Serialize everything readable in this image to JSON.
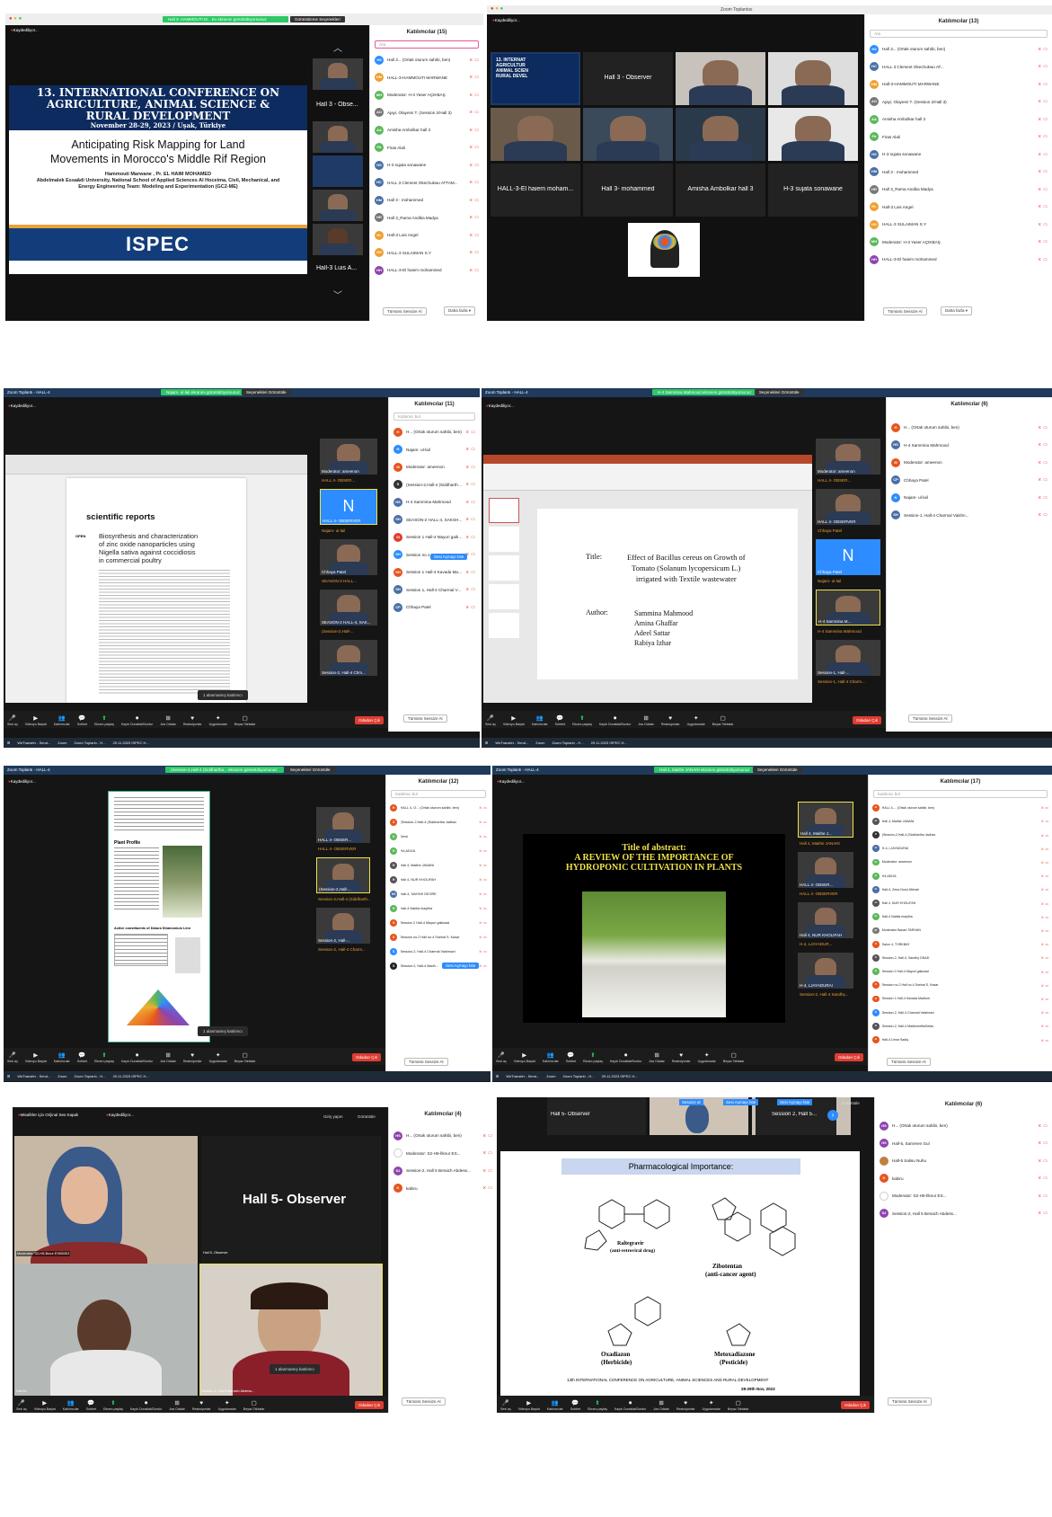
{
  "sc1": {
    "record_label": "Kaydediliyor...",
    "share_banner": "Hall 3- HAMMOUTI M... Ev ekranını görüntülüyorsunuz",
    "view_options": "Görüntüleme Seçenekleri",
    "conf_title_1": "13. INTERNATIONAL CONFERENCE ON",
    "conf_title_2": "AGRICULTURE, ANIMAL SCIENCE &",
    "conf_title_3": "RURAL DEVELOPMENT",
    "conf_date": "November 28-29, 2023 / Uşak, Türkiye",
    "talk_title_1": "Anticipating Risk Mapping for Land",
    "talk_title_2": "Movements in Morocco's Middle Rif Region",
    "authors": "Hammouti Marwane , Pr. EL HAIM MOHAMED",
    "affiliation_1": "Abdelmalek Essaâdi University, National School of Applied Sciences Al Hoceima, Civil, Mechanical, and",
    "affiliation_2": "Energy Engineering Team: Modeling and Experimentation (GC2-ME)",
    "logo_text": "ISPEC",
    "thumb_labels": [
      "Hall 3 - Obse...",
      "Hall-3 Luis A..."
    ],
    "panel_title": "Katılımcılar (15)",
    "search": "Ara",
    "participants": [
      {
        "i": "H3",
        "n": "Hall 3... (Ortak oturum sahibi, ben)",
        "c": "#2d8cff"
      },
      {
        "i": "HM",
        "n": "HALL-3-HAMMOUTI MARWANE",
        "c": "#f0a030"
      },
      {
        "i": "MH",
        "n": "Moderator: H-3 Yaser AÇIKBAŞ",
        "c": "#5cb85c"
      },
      {
        "i": "AO",
        "n": "Ajayi, Olayemi T. (Session 2/Hall 3)",
        "c": "#777"
      },
      {
        "i": "AA",
        "n": "Amisha Ambolkar hall 3",
        "c": "#5cb85c"
      },
      {
        "i": "FA",
        "n": "Firas Alali",
        "c": "#5cb85c"
      },
      {
        "i": "HS",
        "n": "H-3 sujata sonawane",
        "c": "#4a6fa5"
      },
      {
        "i": "HC",
        "n": "HALL 3 Clement Okechukwu ATTAM...",
        "c": "#4a6fa5"
      },
      {
        "i": "HM",
        "n": "Hall 3 - mohammed",
        "c": "#4a6fa5"
      },
      {
        "i": "HR",
        "n": "Hall 3_Rama Andika Madya",
        "c": "#777"
      },
      {
        "i": "HL",
        "n": "Hall-3 Luis Angel",
        "c": "#f0a030"
      },
      {
        "i": "HS",
        "n": "HALL-3 SULAIMAN S.Y",
        "c": "#f0a030"
      },
      {
        "i": "HH",
        "n": "HALL-3-El haiem mohammed",
        "c": "#8e44ad"
      }
    ],
    "invite": "Tümünü Sessize Al",
    "more": "Daha fazla ▾"
  },
  "sc2": {
    "window_title": "Zoom Toplantısı",
    "record_label": "Kaydediliyor...",
    "tiles": [
      "",
      "Hall 3 - Observer",
      "",
      "",
      "",
      "",
      "",
      "",
      "HALL-3-El haiem moham...",
      "Hall 3- mohammed",
      "Amisha Ambolkar hall 3",
      "H-3 sujata sonawane"
    ],
    "mini_slide": [
      "13. INTERNAT",
      "AGRICULTUR",
      "ANIMAL SCIEN",
      "RURAL DEVEL"
    ],
    "panel_title": "Katılımcılar (13)",
    "search": "Ara",
    "participants": [
      {
        "i": "H3",
        "n": "Hall 3... (Ortak oturum sahibi, ben)",
        "c": "#2d8cff"
      },
      {
        "i": "HC",
        "n": "HALL 3 Clement Okechukwu AT...",
        "c": "#4a6fa5"
      },
      {
        "i": "HM",
        "n": "Hall-3-HAMMOUTI MARWANE",
        "c": "#f0a030"
      },
      {
        "i": "AO",
        "n": "Ajayi, Olayemi T. (Session 2/Hall 3)",
        "c": "#777"
      },
      {
        "i": "AA",
        "n": "Amisha Ambolkar hall 3",
        "c": "#5cb85c"
      },
      {
        "i": "FA",
        "n": "Firas Alali",
        "c": "#5cb85c"
      },
      {
        "i": "HS",
        "n": "H-3 sujata sonawane",
        "c": "#4a6fa5"
      },
      {
        "i": "HM",
        "n": "Hall 3 - mohammed",
        "c": "#4a6fa5"
      },
      {
        "i": "HR",
        "n": "Hall 3_Rama Andika Madya",
        "c": "#777"
      },
      {
        "i": "HL",
        "n": "Hall-3 Luis Angel",
        "c": "#f0a030"
      },
      {
        "i": "HS",
        "n": "HALL-3 SULAIMAN S.Y",
        "c": "#f0a030"
      },
      {
        "i": "MH",
        "n": "Moderator: H-3 Yaser AÇIKBAŞ",
        "c": "#5cb85c"
      },
      {
        "i": "HH",
        "n": "HALL-3-El haiem mohammed",
        "c": "#8e44ad"
      }
    ],
    "invite": "Tümünü Sessize Al",
    "more": "Daha fazla ▾"
  },
  "sc3": {
    "window_title": "Zoom Toplantı - HALL-4",
    "share_banner": "Najam- ul-lail ekranını görüntülüyorsunuz",
    "view_options": "Seçenekleri Görüntüle",
    "record_label": "Kaydediliyor...",
    "journal": "scientific reports",
    "open_tag": "OPEN",
    "paper_title": [
      "Biosynthesis and characterization",
      "of zinc oxide nanoparticles using",
      "Nigella sativa against coccidiosis",
      "in commercial poultry"
    ],
    "thumbs": [
      "Moderator: ameenon",
      "HALL 4- OBSER...",
      "HALL 4- OBSERVER",
      "Najam- ul-lail",
      "Chhaya Patel",
      "SEASON-2 HALL...",
      "SEASON-2 HALL-4, SAK...",
      "(Session-2,Hall-...",
      "Session-2, Hall-4 Chm..."
    ],
    "avatar_letter": "N",
    "panel_title": "Katılımcılar (11)",
    "search": "Katılımcı bul",
    "participants": [
      {
        "i": "H",
        "n": "H... (Ortak oturum sahibi, ben)",
        "c": "#e8541e"
      },
      {
        "i": "N",
        "n": "Najam- ul-lail",
        "c": "#2d8cff"
      },
      {
        "i": "M",
        "n": "Moderator: ameenon",
        "c": "#e8541e"
      },
      {
        "i": "S",
        "n": "(Session-2,Hall-4 (Siddhartha Ja...",
        "c": "#333"
      },
      {
        "i": "HS",
        "n": "H-4 Sammina Mahmood",
        "c": "#4a6fa5"
      },
      {
        "i": "SH",
        "n": "SEASON-2 HALL-4, SAKSHI DEO...",
        "c": "#4a6fa5"
      },
      {
        "i": "SI",
        "n": "Session 1 Hall-4 Mayuri gaikwad",
        "c": "#e03c31"
      },
      {
        "i": "SH",
        "n": "Session no.1...",
        "c": "#2d8cff"
      },
      {
        "i": "SH",
        "n": "Session 1 Hall-4 Kavada Madhuri",
        "c": "#e8541e"
      },
      {
        "i": "SH",
        "n": "Session 1, Hall-4 Charmal Vaishn...",
        "c": "#4a6fa5"
      },
      {
        "i": "CP",
        "n": "Chhaya Patel",
        "c": "#4a6fa5"
      }
    ],
    "ask_unmute": "Sesi Açmayı İste",
    "mute_all": "Tümünü Sessize Al",
    "participants_pill": "1 alanmamış katılımcı",
    "toolbar": [
      "Sesi aç",
      "Videoyu Başlat",
      "Katılımcılar",
      "Sohbet",
      "Ekranı paylaş",
      "Kaydı Duraklat/Durdur",
      "Ara Odalar",
      "Reaksiyonlar",
      "Uygulamalar",
      "Beyaz Tahtalar"
    ],
    "leave": "Odadan Çık",
    "taskbar": [
      "WeTransfer - Send...",
      "Zoom",
      "Zoom Toplantı - H...",
      "29.11.2023 ISPEC H..."
    ]
  },
  "sc4": {
    "window_title": "Zoom Toplantı - HALL-4",
    "share_banner": "H-4 Sammina Mahmood ekranını görüntülüyorsunuz",
    "view_options": "Seçenekleri Görüntüle",
    "record_label": "Kaydediliyor...",
    "slide_title_label": "Title:",
    "slide_title": [
      "Effect of Bacillus cereus on Growth of",
      "Tomato (Solanum lycopersicum L.)",
      "irrigated with Textile wastewater"
    ],
    "author_label": "Author:",
    "authors": [
      "Sammina Mahmood",
      "Amina Ghaffar",
      "Adeel Sattar",
      "Rabiya Izhar"
    ],
    "thumbs": [
      "Moderator: ameenon",
      "HALL 4- OBSER...",
      "HALL 4- OBSERVER",
      "Chhaya Patel",
      "Chhaya Patel",
      "Najam- ul-lail",
      "H-4 Sammina M...",
      "H-4 Sammina Mahmood",
      "Session-1, Hall-...",
      "Session-1, Hall-4 Charm..."
    ],
    "avatar_letter": "N",
    "panel_title": "Katılımcılar (6)",
    "participants": [
      {
        "i": "H",
        "n": "H... (Ortak oturum sahibi, ben)",
        "c": "#e8541e"
      },
      {
        "i": "HS",
        "n": "H-4 Sammina Mahmood",
        "c": "#4a6fa5"
      },
      {
        "i": "M",
        "n": "Moderator: ameenon",
        "c": "#e8541e"
      },
      {
        "i": "CP",
        "n": "Chhaya Patel",
        "c": "#4a6fa5"
      },
      {
        "i": "N",
        "n": "Najam- ul-lail",
        "c": "#2d8cff"
      },
      {
        "i": "SH",
        "n": "Session-1, Hall-4 Charmal Vaishn...",
        "c": "#4a6fa5"
      }
    ],
    "mute_all": "Tümünü Sessize Al",
    "leave": "Odadan Çık"
  },
  "sc5": {
    "window_title": "Zoom Toplantı - HALL-4",
    "share_banner": "(Session-2,Hall-4 (Siddhartha... ekranını görüntülüyorsunuz",
    "view_options": "Seçenekleri Görüntüle",
    "record_label": "Kaydediliyor...",
    "doc_heading": "Plant Profile",
    "doc_heading2": "Active constituents of Datura Stramonium Linn",
    "thumbs": [
      "HALL 4- OBSER...",
      "HALL 4- OBSERVER",
      "(Session-2,Hall-...",
      "Session-2,Hall-4 (Siddharth...",
      "Session-2, Hall-...",
      "Session-2, Hall-4 Charm..."
    ],
    "panel_title": "Katılımcılar (12)",
    "participants": [
      {
        "i": "H",
        "n": "HALL 4- O... (Ortak oturum sahibi, ben)",
        "c": "#e8541e"
      },
      {
        "i": "S",
        "n": "(Session-2,Hall-4 (Siddhartha Jadhav",
        "c": "#e8541e"
      },
      {
        "i": "D",
        "n": "Dewi",
        "c": "#5cb85c"
      },
      {
        "i": "H",
        "n": "H4,ADIJA",
        "c": "#5cb85c"
      },
      {
        "i": "H",
        "n": "Hall 4, Maithe JANANI",
        "c": "#555"
      },
      {
        "i": "H",
        "n": "Hall 4, NUR KHOLIFAH",
        "c": "#555"
      },
      {
        "i": "HS",
        "n": "Hall-4, SAKSHI DEORE",
        "c": "#4a6fa5"
      },
      {
        "i": "H",
        "n": "Hall-4 Nabila mayliha",
        "c": "#5cb85c"
      },
      {
        "i": "S",
        "n": "Session 2 Hall-4 Mayuri gaikwad",
        "c": "#e8541e"
      },
      {
        "i": "S",
        "n": "Session no.2 Hall no.4 Snehal S. Kasar",
        "c": "#e8541e"
      },
      {
        "i": "S",
        "n": "Session-2, Hall-4 Charmal Vaishnavi",
        "c": "#2d8cff"
      },
      {
        "i": "S",
        "n": "Session-2, Hall-4 Madh...",
        "c": "#222"
      }
    ],
    "ask_unmute": "Sesi Açmayı İste",
    "mute_all": "Tümünü Sessize Al",
    "participants_pill": "1 alanmamış katılımcı",
    "leave": "Odadan Çık"
  },
  "sc6": {
    "window_title": "Zoom Toplantı - HALL-4",
    "share_banner": "Hall 4, Maithe JANANI ekranını görüntülüyorsunuz",
    "view_options": "Seçenekleri Görüntüle",
    "record_label": "Kaydediliyor...",
    "slide_line1": "Title of abstract:",
    "slide_line2": "A REVIEW OF THE IMPORTANCE OF",
    "slide_line3": "HYDROPONIC CULTIVATION IN PLANTS",
    "thumbs": [
      "Hall 4, Maithe J...",
      "Hall 4, Maithe JANANI",
      "HALL 4- OBSER...",
      "HALL 4- OBSERVER",
      "Hall 4, NUR KHOLIFAH",
      "H-4, LJAYADUR...",
      "H-4, LJAYADURAI",
      "Session-2, Hall-4 Sandhy..."
    ],
    "panel_title": "Katılımcılar (17)",
    "participants": [
      {
        "i": "H",
        "n": "HALL 4-... (Ortak oturum sahibi, ben)",
        "c": "#e8541e"
      },
      {
        "i": "H",
        "n": "Hall 4, Maithe JANANI",
        "c": "#555"
      },
      {
        "i": "S",
        "n": "(Session-2,Hall-4 (Siddhartha Jadhav",
        "c": "#333"
      },
      {
        "i": "H",
        "n": "H-4, LJAYADURAI",
        "c": "#4a6fa5"
      },
      {
        "i": "H",
        "n": "Moderator: ameenon",
        "c": "#5cb85c"
      },
      {
        "i": "H",
        "n": "H4,ADIJA",
        "c": "#5cb85c"
      },
      {
        "i": "H",
        "n": "Hall-4, Zena Nurul Afierah",
        "c": "#4a6fa5"
      },
      {
        "i": "H",
        "n": "Hall 4, NUR KHOLIFAH",
        "c": "#555"
      },
      {
        "i": "H",
        "n": "Hall-4 Nabila mayliha",
        "c": "#5cb85c"
      },
      {
        "i": "M",
        "n": "Moderator Banan TARHAN",
        "c": "#777"
      },
      {
        "i": "S",
        "n": "Salon 4, TORKBAY",
        "c": "#e8541e"
      },
      {
        "i": "S",
        "n": "Session-2, Hall-4, Sandhy DNAD",
        "c": "#555"
      },
      {
        "i": "S",
        "n": "Session 2 Hall-4 Mayuri gaikwad",
        "c": "#5cb85c"
      },
      {
        "i": "S",
        "n": "Session no.2 Hall no.4 Snehal S. Kasar",
        "c": "#e8541e"
      },
      {
        "i": "S",
        "n": "Session 1 Hall-4 Kavada Madhuri",
        "c": "#e8541e"
      },
      {
        "i": "S",
        "n": "Session-2, Hall-4 Charmal Vaishnavi",
        "c": "#2d8cff"
      },
      {
        "i": "S",
        "n": "Session-2, Hall-4 MadhumithaGelas",
        "c": "#555"
      },
      {
        "i": "H",
        "n": "Hall-4 Umar Sadiq",
        "c": "#e8541e"
      }
    ],
    "mute_all": "Tümünü Sessize Al",
    "leave": "Odadan Çık"
  },
  "sc7": {
    "tab1": "Misafirler için Orijinal Ses Kapalı",
    "record_label": "Kaydediliyor...",
    "grid": "Giriş yapın",
    "view": "Görüntüle",
    "unmute": "Sesi aç",
    "hall_label": "Hall 5- Observer",
    "tile_labels": [
      "Moderator: S2-H5-İlknur ESKİMEZ",
      "Hall 5- Observer",
      "Hall-Ku",
      "Session-2, Hall 5 Beraich Abdess..."
    ],
    "participants_pill": "1 alanmamış katılımcı",
    "panel_title": "Katılımcılar (4)",
    "participants": [
      {
        "i": "HS",
        "n": "H... (Ortak oturum sahibi, ben)",
        "c": "#8e44ad"
      },
      {
        "i": "",
        "n": "Moderator: S2-H5-İlknur ES...",
        "c": "#fff"
      },
      {
        "i": "S2",
        "n": "Session-2, Hall 5 Beraich Abdess...",
        "c": "#8e44ad"
      },
      {
        "i": "K",
        "n": "kabiru",
        "c": "#e8541e"
      }
    ],
    "mute_all": "Tümünü Sessize Al",
    "leave": "Odadan Çık"
  },
  "sc8": {
    "top_tiles": [
      "Hall 5- Observer",
      "Session 2, Hall 5..."
    ],
    "top_tiles_sub": [
      "Hall 5- Observer",
      "Session 2, Hall 5 Bera..."
    ],
    "pills": [
      "Sessize al",
      "Sesi Açmayı İste",
      "Sesi Açmayı İste",
      "Görüntüle"
    ],
    "slide_heading": "Pharmacological Importance:",
    "compounds": [
      "Raltegravir",
      "(anti-retroviral drug)",
      "Zibotentan",
      "(anti-cancer agent)",
      "Oxadiazon",
      "(Herbicide)",
      "Metoxadiazone",
      "(Pesticide)"
    ],
    "footer": "13th INTERNATIONAL CONFERENCE ON AGRICULTURE, ANIMAL SCIENCES AND RURAL DEVELOPMENT",
    "footer_date": "28-29th Nov, 2023",
    "panel_title": "Katılımcılar (6)",
    "participants": [
      {
        "i": "HS",
        "n": "H... (Ortak oturum sahibi, ben)",
        "c": "#8e44ad"
      },
      {
        "i": "HS",
        "n": "Hall-5, Samreen Gul",
        "c": "#8e44ad"
      },
      {
        "i": "",
        "n": "Hall-5 Salisu Nuhu",
        "c": "#c08040"
      },
      {
        "i": "K",
        "n": "kabiru",
        "c": "#e8541e"
      },
      {
        "i": "",
        "n": "Moderator: S2-H5-İlknur ES...",
        "c": "#fff"
      },
      {
        "i": "S2",
        "n": "Session-2, Hall 5 Beraich Abdess...",
        "c": "#8e44ad"
      }
    ],
    "mute_all": "Tümünü Sessize Al",
    "leave": "Odadan Çık"
  }
}
